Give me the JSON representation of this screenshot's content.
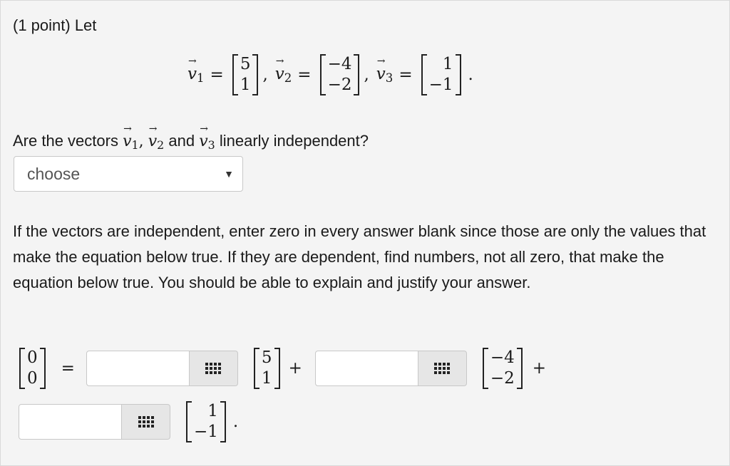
{
  "problem": {
    "header": "(1 point) Let",
    "vectors": [
      {
        "symbol": "v",
        "index": "1",
        "entries": [
          "5",
          "1"
        ]
      },
      {
        "symbol": "v",
        "index": "2",
        "entries": [
          "−4",
          "−2"
        ]
      },
      {
        "symbol": "v",
        "index": "3",
        "entries": [
          "1",
          "−1"
        ]
      }
    ],
    "question_prefix": "Are the vectors",
    "question_and": "and",
    "question_suffix": "linearly independent?",
    "dropdown": {
      "selected": "choose"
    },
    "instructions": "If the vectors are independent, enter zero in every answer blank since those are only the values that make the equation below true. If they are dependent, find numbers, not all zero, that make the equation below true. You should be able to explain and justify your answer.",
    "equation": {
      "zero_vector": [
        "0",
        "0"
      ],
      "v1": [
        "5",
        "1"
      ],
      "v2": [
        "−4",
        "−2"
      ],
      "v3": [
        "1",
        "−1"
      ],
      "equals": "=",
      "plus": "+",
      "period": ".",
      "inputs": [
        {
          "value": ""
        },
        {
          "value": ""
        },
        {
          "value": ""
        }
      ]
    }
  }
}
